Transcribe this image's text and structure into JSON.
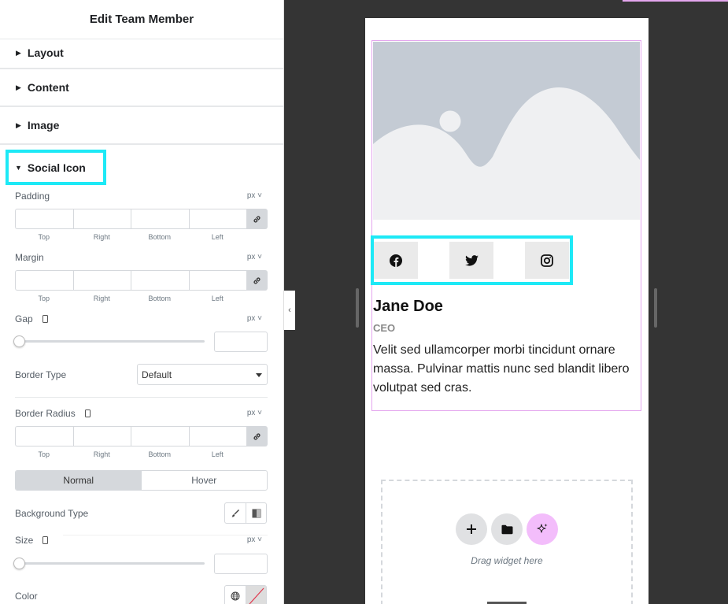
{
  "panel": {
    "title": "Edit Team Member",
    "sections": [
      "Layout",
      "Content",
      "Image"
    ],
    "active_section": "Social Icon"
  },
  "controls": {
    "padding": {
      "label": "Padding",
      "unit": "px"
    },
    "margin": {
      "label": "Margin",
      "unit": "px"
    },
    "gap": {
      "label": "Gap",
      "unit": "px"
    },
    "border_type": {
      "label": "Border Type",
      "value": "Default"
    },
    "border_radius": {
      "label": "Border Radius",
      "unit": "px"
    },
    "dim_labels": [
      "Top",
      "Right",
      "Bottom",
      "Left"
    ],
    "tabs": {
      "normal": "Normal",
      "hover": "Hover"
    },
    "background_type": {
      "label": "Background Type"
    },
    "size": {
      "label": "Size",
      "unit": "px"
    },
    "color": {
      "label": "Color"
    }
  },
  "preview": {
    "member": {
      "name": "Jane Doe",
      "role": "CEO",
      "bio": "Velit sed ullamcorper morbi tincidunt ornare massa. Pulvinar mattis nunc sed blandit libero volutpat sed cras."
    },
    "social_icons": [
      "facebook-icon",
      "twitter-icon",
      "instagram-icon"
    ],
    "drop_zone_text": "Drag widget here"
  },
  "colors": {
    "highlight": "#1de9f6",
    "selection": "#e4a6ee",
    "ai_button": "#f3bdfb",
    "canvas_bg": "#343434"
  }
}
